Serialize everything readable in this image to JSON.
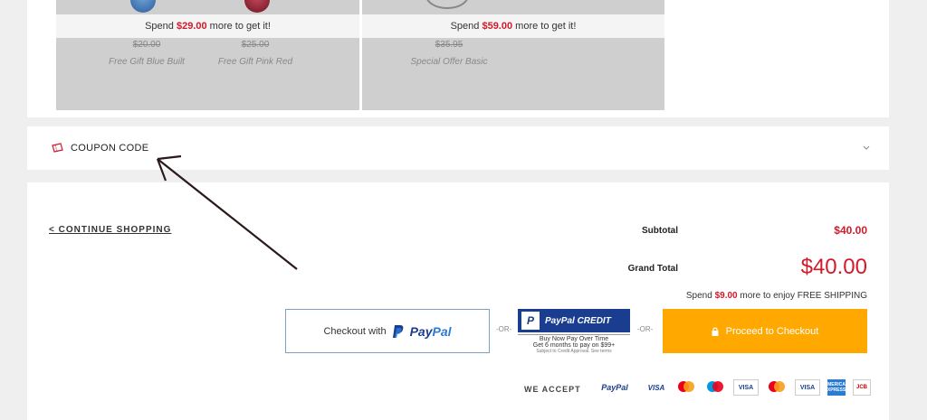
{
  "gifts": {
    "card1": {
      "spend_prefix": "Spend ",
      "spend_amount": "$29.00",
      "spend_suffix": " more to get it!",
      "items": [
        {
          "old_price": "$20.00",
          "name": "Free Gift Blue Built"
        },
        {
          "old_price": "$25.00",
          "name": "Free Gift Pink Red"
        }
      ]
    },
    "card2": {
      "spend_prefix": "Spend ",
      "spend_amount": "$59.00",
      "spend_suffix": " more to get it!",
      "items": [
        {
          "old_price": "$35.95",
          "name": "Special Offer Basic"
        }
      ]
    }
  },
  "coupon": {
    "label": "COUPON CODE",
    "icon": "ticket-icon"
  },
  "summary": {
    "continue_label": "< CONTINUE SHOPPING",
    "subtotal_label": "Subtotal",
    "subtotal_value": "$40.00",
    "grand_total_label": "Grand Total",
    "grand_total_value": "$40.00",
    "free_ship_prefix": "Spend ",
    "free_ship_amount": "$9.00",
    "free_ship_suffix": " more to enjoy FREE SHIPPING"
  },
  "checkout": {
    "paypal_prefix": "Checkout with",
    "paypal_brand_1": "Pay",
    "paypal_brand_2": "Pal",
    "or_1": "-OR-",
    "or_2": "-OR-",
    "credit_title": "PayPal CREDIT",
    "credit_line1": "Buy Now Pay Over Time",
    "credit_line2": "Get 6 months to pay on $99+",
    "credit_line3": "Subject to Credit Approval. See terms",
    "proceed_label": "Proceed to Checkout"
  },
  "payments": {
    "we_accept": "WE ACCEPT",
    "paypal": "PayPal",
    "visa": "VISA",
    "visa_electron": "VISA",
    "visa_electron_sub": "Electron",
    "amex": "AMERICAN EXPRESS",
    "jcb": "JCB"
  },
  "colors": {
    "accent_red": "#d11a2a",
    "checkout_orange": "#ffa800",
    "paypal_blue": "#1a3d8f"
  }
}
